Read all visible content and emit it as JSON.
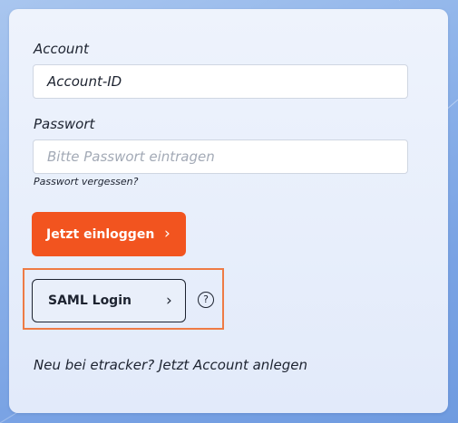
{
  "form": {
    "account_label": "Account",
    "account_value": "Account-ID",
    "password_label": "Passwort",
    "password_placeholder": "Bitte Passwort eintragen",
    "forgot_password": "Passwort vergessen?",
    "login_button": "Jetzt einloggen",
    "login_chevron": "›",
    "saml_button": "SAML Login",
    "saml_chevron": "›",
    "help_icon": "?",
    "signup_prefix": "Neu bei etracker?",
    "signup_link": "Jetzt Account anlegen"
  },
  "colors": {
    "primary_button": "#f2541f",
    "highlight_border": "#ee7b45",
    "text": "#1d2330",
    "background": "#8fb4ea"
  },
  "icons": {
    "login_chevron": "chevron-right-icon",
    "saml_chevron": "chevron-right-icon",
    "help": "question-circle-icon"
  }
}
